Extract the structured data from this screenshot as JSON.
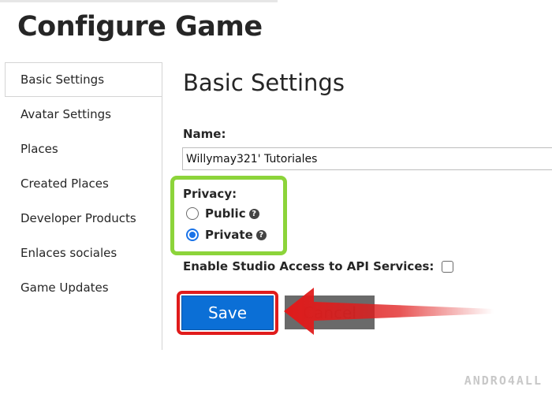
{
  "page": {
    "title": "Configure Game"
  },
  "sidebar": {
    "items": [
      {
        "label": "Basic Settings",
        "active": true
      },
      {
        "label": "Avatar Settings"
      },
      {
        "label": "Places"
      },
      {
        "label": "Created Places"
      },
      {
        "label": "Developer Products"
      },
      {
        "label": "Enlaces sociales"
      },
      {
        "label": "Game Updates"
      }
    ]
  },
  "main": {
    "section_title": "Basic Settings",
    "name": {
      "label": "Name:",
      "value": "Willymay321' Tutoriales"
    },
    "privacy": {
      "label": "Privacy:",
      "options": [
        {
          "label": "Public",
          "selected": false,
          "help_icon": "question-circle-icon"
        },
        {
          "label": "Private",
          "selected": true,
          "help_icon": "question-circle-icon"
        }
      ],
      "highlight_color": "#8cd43a"
    },
    "api_access": {
      "label": "Enable Studio Access to API Services:",
      "checked": false
    },
    "buttons": {
      "save_label": "Save",
      "cancel_label": "Cancel"
    },
    "save_highlight_color": "#e01b1b",
    "arrow_color": "#e01b1b"
  },
  "watermark": "ANDRO4ALL",
  "colors": {
    "primary": "#0b6fd6",
    "cancel": "#6a6a6a"
  }
}
